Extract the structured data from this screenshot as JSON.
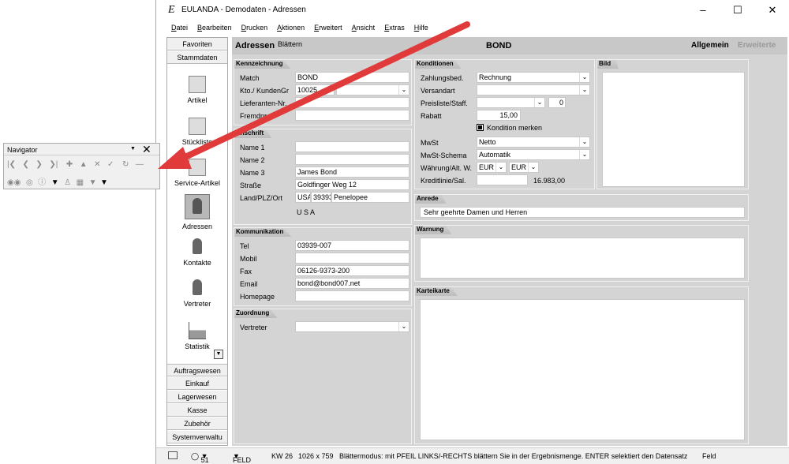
{
  "window": {
    "title": "EULANDA - Demodaten - Adressen"
  },
  "menu": [
    "Datei",
    "Bearbeiten",
    "Drucken",
    "Aktionen",
    "Erweitert",
    "Ansicht",
    "Extras",
    "Hilfe"
  ],
  "nav": {
    "top_groups": [
      "Favoriten",
      "Stammdaten"
    ],
    "items": [
      "Artikel",
      "Stückliste",
      "Service-Artikel",
      "Adressen",
      "Kontakte",
      "Vertreter",
      "Statistik"
    ],
    "bottom_groups": [
      "Auftragswesen",
      "Einkauf",
      "Lagerwesen",
      "Kasse",
      "Zubehör",
      "Systemverwaltu"
    ]
  },
  "header": {
    "title": "Adressen",
    "sub": "Blättern",
    "center": "BOND",
    "tab_active": "Allgemein",
    "tab_inactive": "Erweiterte"
  },
  "kennzeichnung": {
    "title": "Kennzeichnung",
    "match_label": "Match",
    "match_value": "BOND",
    "kto_label": "Kto./ KundenGr",
    "kto_value": "10025",
    "lief_label": "Lieferanten-Nr.",
    "fremd_label": "Fremdnr."
  },
  "anschrift": {
    "title": "Anschrift",
    "name1_label": "Name 1",
    "name2_label": "Name 2",
    "name3_label": "Name 3",
    "name3_value": "James Bond",
    "strasse_label": "Straße",
    "strasse_value": "Goldfinger Weg 12",
    "land_label": "Land/PLZ/Ort",
    "land": "USA",
    "plz": "39393",
    "ort": "Penelopee",
    "country": "U S A"
  },
  "kommunikation": {
    "title": "Kommunikation",
    "tel_label": "Tel",
    "tel": "03939-007",
    "mobil_label": "Mobil",
    "fax_label": "Fax",
    "fax": "06126-9373-200",
    "email_label": "Email",
    "email": "bond@bond007.net",
    "homepage_label": "Homepage"
  },
  "zuordnung": {
    "title": "Zuordnung",
    "vertreter_label": "Vertreter"
  },
  "konditionen": {
    "title": "Konditionen",
    "zahlung_label": "Zahlungsbed.",
    "zahlung": "Rechnung",
    "versand_label": "Versandart",
    "preis_label": "Preisliste/Staff.",
    "preis_staff": "0",
    "rabatt_label": "Rabatt",
    "rabatt": "15,00",
    "kond_merken": "Kondition merken",
    "mwst_label": "MwSt",
    "mwst": "Netto",
    "mwst_schema_label": "MwSt-Schema",
    "mwst_schema": "Automatik",
    "waehrung_label": "Währung/Alt. W.",
    "waehrung": "EUR",
    "alt_waehrung": "EUR",
    "kredit_label": "Kreditlinie/Sal.",
    "kredit_saldo": "16.983,00"
  },
  "bild": {
    "title": "Bild"
  },
  "anrede": {
    "title": "Anrede",
    "value": "Sehr geehrte Damen und Herren"
  },
  "warnung": {
    "title": "Warnung"
  },
  "karteikarte": {
    "title": "Karteikarte"
  },
  "statusbar": {
    "count": "51",
    "mode": "FELD",
    "kw": "KW 26",
    "res": "1026 x 759",
    "message": "Blättermodus: mit PFEIL LINKS/-RECHTS blättern Sie in der Ergebnismenge. ENTER selektiert den Datensatz",
    "field": "Feld"
  },
  "navigator": {
    "title": "Navigator"
  }
}
